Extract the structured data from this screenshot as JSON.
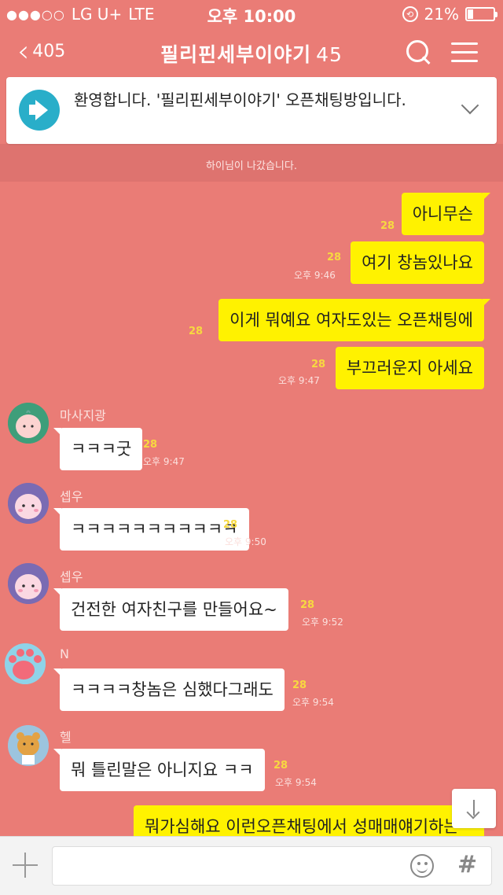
{
  "status_bar": {
    "signal_dots": "●●●○○",
    "carrier": "LG U+",
    "network": "LTE",
    "time": "오후 10:00",
    "battery_percent": "21%",
    "battery_level": 0.21
  },
  "header": {
    "back_count": "405",
    "title": "필리핀세부이야기",
    "member_count": "45"
  },
  "notice": {
    "text": "환영합니다. '필리핀세부이야기' 오픈채팅방입니다."
  },
  "system_message": "하이님이 나갔습니다.",
  "messages": [
    {
      "sender": "",
      "text": "아니무슨",
      "unread": "28",
      "time": "",
      "mine": true
    },
    {
      "sender": "",
      "text": "여기 창놈있나요",
      "unread": "28",
      "time": "오후 9:46",
      "mine": true
    },
    {
      "sender": "",
      "text": "이게 뭐예요 여자도있는 오픈채팅에",
      "unread": "28",
      "time": "",
      "mine": true
    },
    {
      "sender": "",
      "text": "부끄러운지 아세요",
      "unread": "28",
      "time": "오후 9:47",
      "mine": true
    },
    {
      "sender": "마사지광",
      "text": "ㅋㅋㅋ굿",
      "unread": "28",
      "time": "오후 9:47",
      "mine": false
    },
    {
      "sender": "셉우",
      "text": "ㅋㅋㅋㅋㅋㅋㅋㅋㅋㅋㅋ",
      "unread": "28",
      "time": "오후 9:50",
      "mine": false
    },
    {
      "sender": "셉우",
      "text": "건전한 여자친구를 만들어요~",
      "unread": "28",
      "time": "오후 9:52",
      "mine": false
    },
    {
      "sender": "N",
      "text": "ㅋㅋㅋㅋ창놈은 심했다그래도",
      "unread": "28",
      "time": "오후 9:54",
      "mine": false
    },
    {
      "sender": "헬",
      "text": "뭐 틀린말은 아니지요 ㅋㅋ",
      "unread": "28",
      "time": "오후 9:54",
      "mine": false
    },
    {
      "sender": "",
      "text": "뭐가심해요 이런오픈채팅에서 성매매얘기하는",
      "unread": "",
      "time": "",
      "mine": true
    }
  ],
  "input": {
    "placeholder": "",
    "hash_label": "#"
  }
}
